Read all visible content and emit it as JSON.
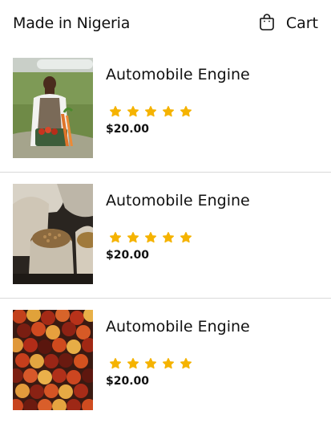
{
  "header": {
    "title": "Made in Nigeria",
    "cart_label": "Cart",
    "cart_icon": "shopping-bag-icon"
  },
  "products": [
    {
      "title": "Automobile Engine",
      "price": "$20.00",
      "rating": 5,
      "rating_max": 5,
      "image": "farmer-with-vegetables-photo"
    },
    {
      "title": "Automobile Engine",
      "price": "$20.00",
      "rating": 5,
      "rating_max": 5,
      "image": "grain-sacks-photo"
    },
    {
      "title": "Automobile Engine",
      "price": "$20.00",
      "rating": 5,
      "rating_max": 5,
      "image": "palm-fruit-photo"
    }
  ],
  "colors": {
    "star": "#f5b301",
    "divider": "#d9d9d9",
    "text": "#111111"
  }
}
